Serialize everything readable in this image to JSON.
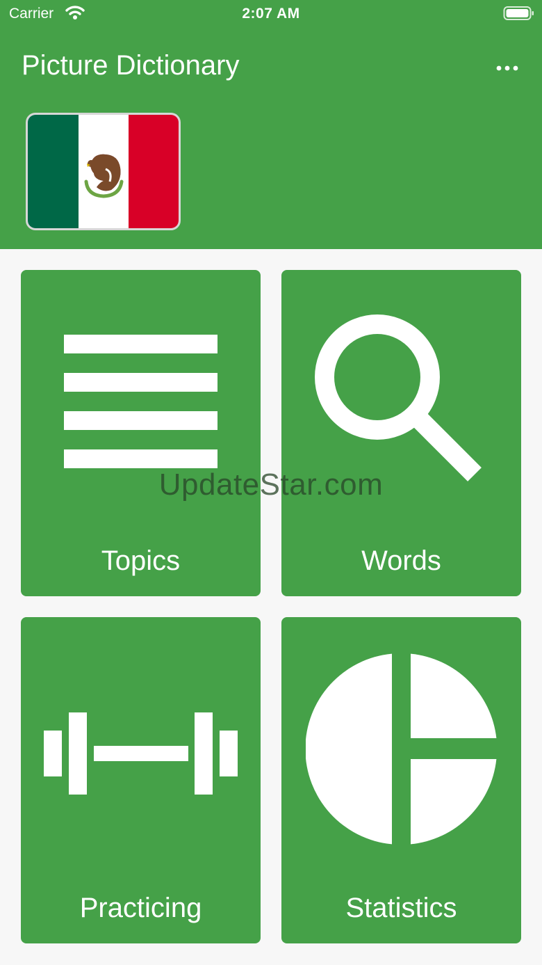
{
  "status_bar": {
    "carrier": "Carrier",
    "time": "2:07 AM"
  },
  "header": {
    "title": "Picture Dictionary",
    "menu_icon": "more-dots-icon",
    "flag": "mexico-flag"
  },
  "tiles": [
    {
      "label": "Topics",
      "icon": "list-icon"
    },
    {
      "label": "Words",
      "icon": "search-icon"
    },
    {
      "label": "Practicing",
      "icon": "dumbbell-icon"
    },
    {
      "label": "Statistics",
      "icon": "pie-chart-icon"
    }
  ],
  "watermark": "UpdateStar.com",
  "colors": {
    "primary": "#45a148",
    "background": "#f7f7f7",
    "flag_green": "#006847",
    "flag_red": "#d80027"
  }
}
